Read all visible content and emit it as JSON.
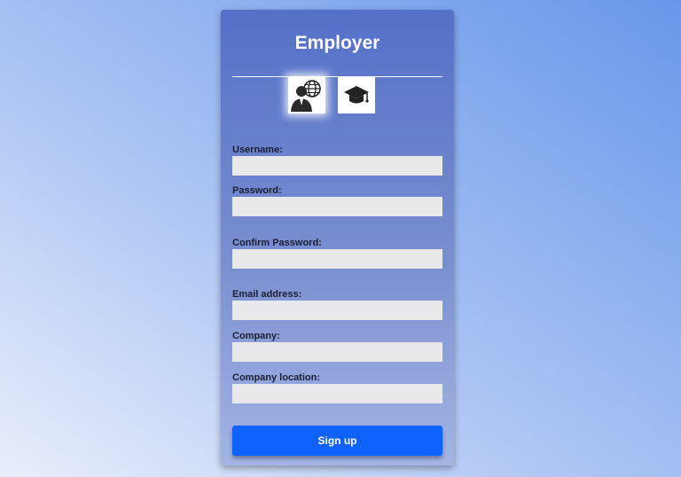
{
  "form": {
    "title": "Employer",
    "roles": [
      {
        "icon": "employer-globe-person-icon",
        "selected": true
      },
      {
        "icon": "graduation-cap-icon",
        "selected": false
      }
    ],
    "fields": [
      {
        "label": "Username:",
        "value": "",
        "placeholder": ""
      },
      {
        "label": "Password:",
        "value": "",
        "placeholder": ""
      },
      {
        "label": "Confirm Password:",
        "value": "",
        "placeholder": ""
      },
      {
        "label": "Email address:",
        "value": "",
        "placeholder": ""
      },
      {
        "label": "Company:",
        "value": "",
        "placeholder": ""
      },
      {
        "label": "Company location:",
        "value": "",
        "placeholder": ""
      }
    ],
    "submit_label": "Sign up"
  },
  "colors": {
    "card_top": "#5470c8",
    "button": "#0f62fe",
    "input_bg": "#e9e9ec"
  }
}
